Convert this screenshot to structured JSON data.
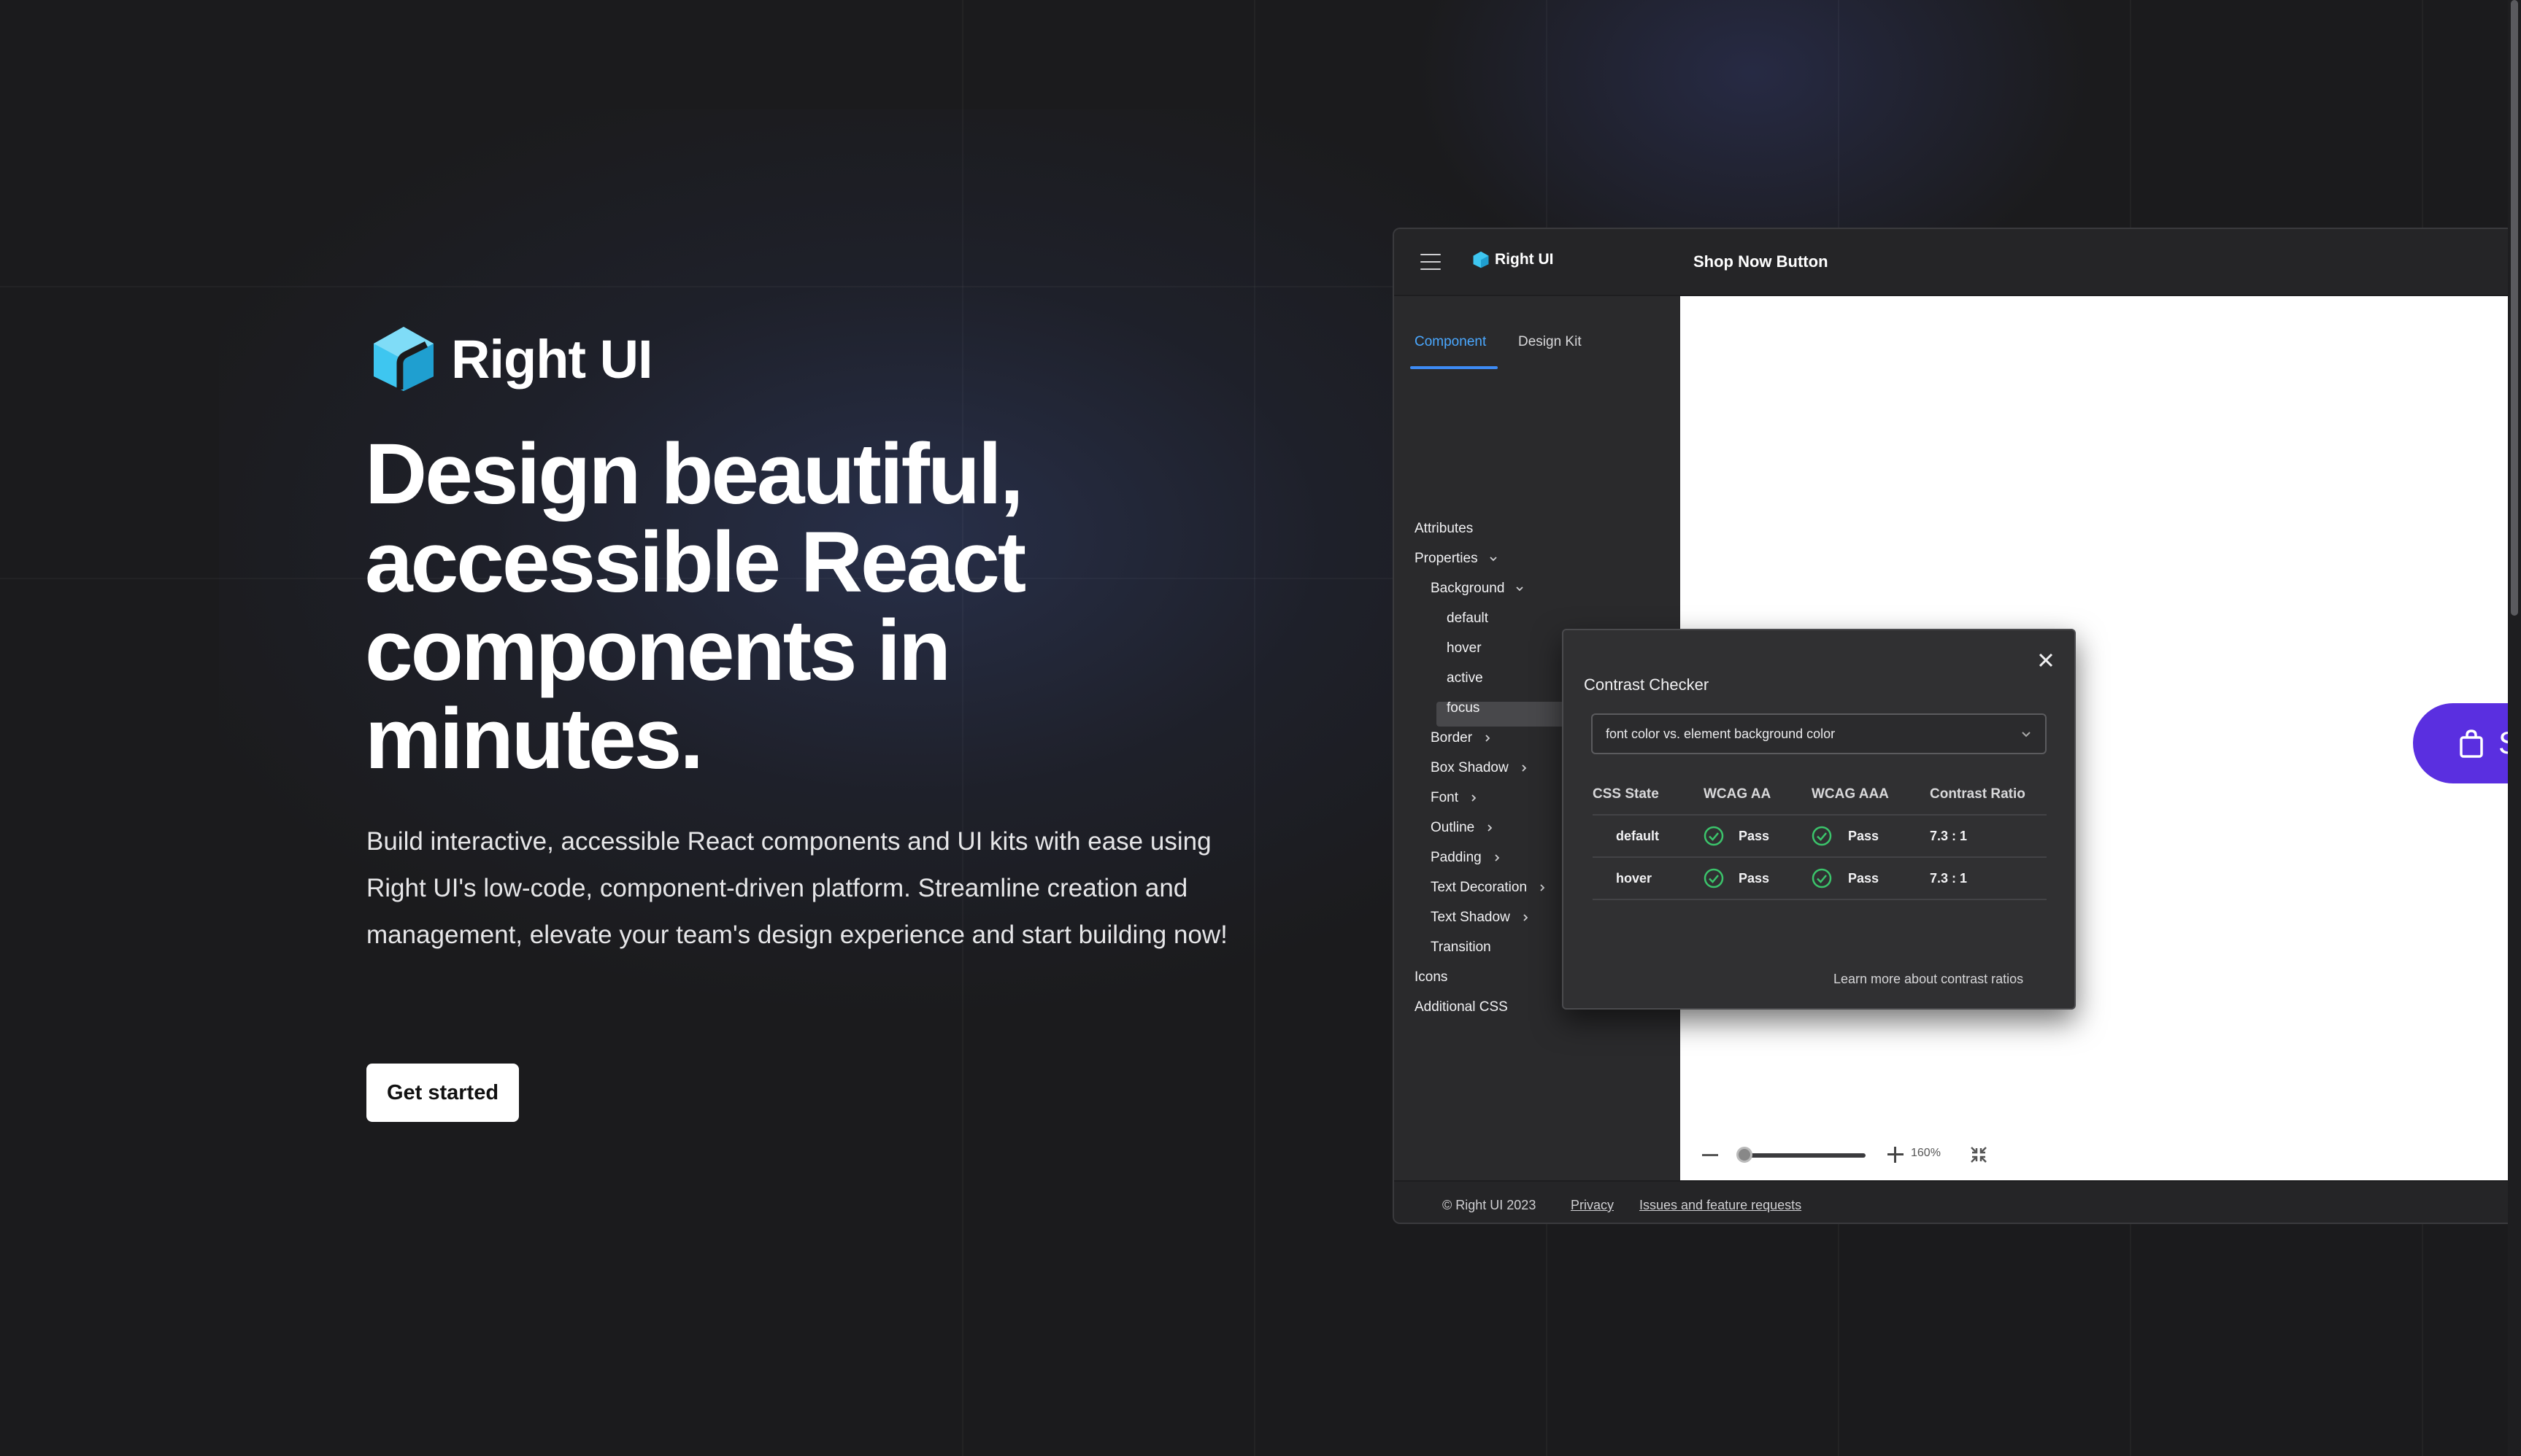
{
  "colors": {
    "page_bg": "#1b1b1d",
    "accent_blue": "#4aa8ff",
    "brand_cyan": "#3ec6f0",
    "shop_purple": "#5a2fe0",
    "pass_green": "#3bc46b"
  },
  "hero": {
    "brand": "Right UI",
    "headline": "Design beautiful, accessible React components in minutes.",
    "subtext": "Build interactive, accessible React components and UI kits with ease using Right UI's low-code, component-driven platform. Streamline creation and management, elevate your team's design experience and start building now!",
    "cta": "Get started"
  },
  "app": {
    "logo": "Right UI",
    "title": "Shop Now Button",
    "tabs": [
      {
        "label": "Component",
        "active": true
      },
      {
        "label": "Design Kit",
        "active": false
      }
    ],
    "nav": [
      {
        "label": "Attributes"
      },
      {
        "label": "Properties",
        "chevron": "down"
      },
      {
        "label": "Background",
        "chevron": "down"
      },
      {
        "label": "default",
        "selected": true
      },
      {
        "label": "hover"
      },
      {
        "label": "active"
      },
      {
        "label": "focus"
      },
      {
        "label": "Border",
        "chevron": "right"
      },
      {
        "label": "Box Shadow",
        "chevron": "right"
      },
      {
        "label": "Font",
        "chevron": "right"
      },
      {
        "label": "Outline",
        "chevron": "right"
      },
      {
        "label": "Padding",
        "chevron": "right"
      },
      {
        "label": "Text Decoration",
        "chevron": "right"
      },
      {
        "label": "Text Shadow",
        "chevron": "right"
      },
      {
        "label": "Transition"
      },
      {
        "label": "Icons"
      },
      {
        "label": "Additional CSS"
      }
    ],
    "canvas": {
      "shop_button_label": "SHOP NOW",
      "zoom_level": "160%"
    },
    "footer": {
      "copyright": "© Right UI 2023",
      "privacy": "Privacy",
      "issues": "Issues and feature requests"
    }
  },
  "contrast_checker": {
    "title": "Contrast Checker",
    "select_value": "font color vs. element background color",
    "columns": [
      "CSS State",
      "WCAG AA",
      "WCAG AAA",
      "Contrast Ratio"
    ],
    "rows": [
      {
        "state": "default",
        "aa": "Pass",
        "aaa": "Pass",
        "ratio": "7.3 : 1"
      },
      {
        "state": "hover",
        "aa": "Pass",
        "aaa": "Pass",
        "ratio": "7.3 : 1"
      }
    ],
    "link": "Learn more about contrast ratios"
  }
}
